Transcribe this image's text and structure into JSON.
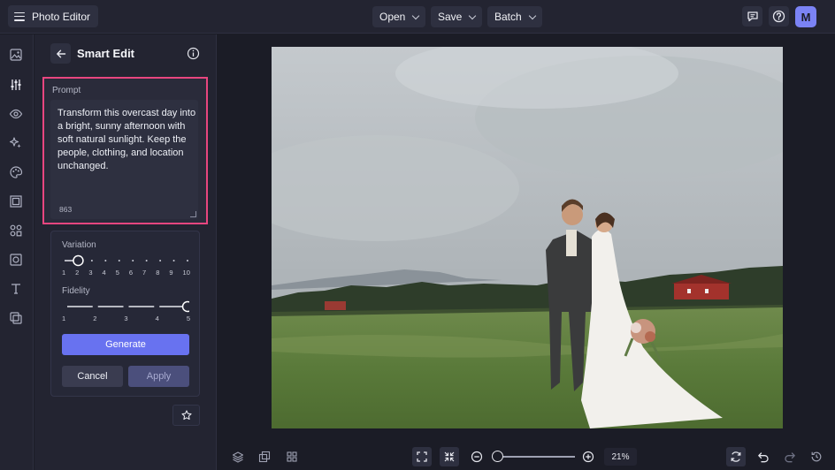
{
  "app": {
    "title": "Photo Editor",
    "avatar_initial": "M"
  },
  "topmenu": {
    "open": "Open",
    "save": "Save",
    "batch": "Batch"
  },
  "panel": {
    "title": "Smart Edit",
    "prompt_label": "Prompt",
    "prompt_text": "Transform this overcast day into a bright, sunny afternoon with soft natural sunlight. Keep the people, clothing, and location unchanged.",
    "char_count": "863",
    "variation": {
      "label": "Variation",
      "ticks": [
        "1",
        "2",
        "3",
        "4",
        "5",
        "6",
        "7",
        "8",
        "9",
        "10"
      ],
      "value": 2
    },
    "fidelity": {
      "label": "Fidelity",
      "ticks": [
        "1",
        "2",
        "3",
        "4",
        "5"
      ],
      "value": 5
    },
    "generate_label": "Generate",
    "cancel_label": "Cancel",
    "apply_label": "Apply"
  },
  "zoom": {
    "label": "21%",
    "value": 21
  },
  "colors": {
    "accent": "#6872f0",
    "highlight": "#e8467f",
    "bg": "#1b1c26",
    "panel": "#232431"
  },
  "icons": {
    "rail": [
      "image-icon",
      "adjust-sliders-icon",
      "eye-icon",
      "sparkle-icon",
      "palette-icon",
      "frame-icon",
      "shapes-icon",
      "texture-icon",
      "text-icon",
      "overlay-icon"
    ],
    "top_right": [
      "feedback-icon",
      "help-icon"
    ],
    "bottom": [
      "layers-icon",
      "duplicate-icon",
      "grid-icon",
      "fit-screen-icon",
      "actual-size-icon",
      "zoom-out-icon",
      "zoom-in-icon",
      "refresh-icon",
      "undo-icon",
      "redo-icon",
      "history-icon"
    ]
  }
}
